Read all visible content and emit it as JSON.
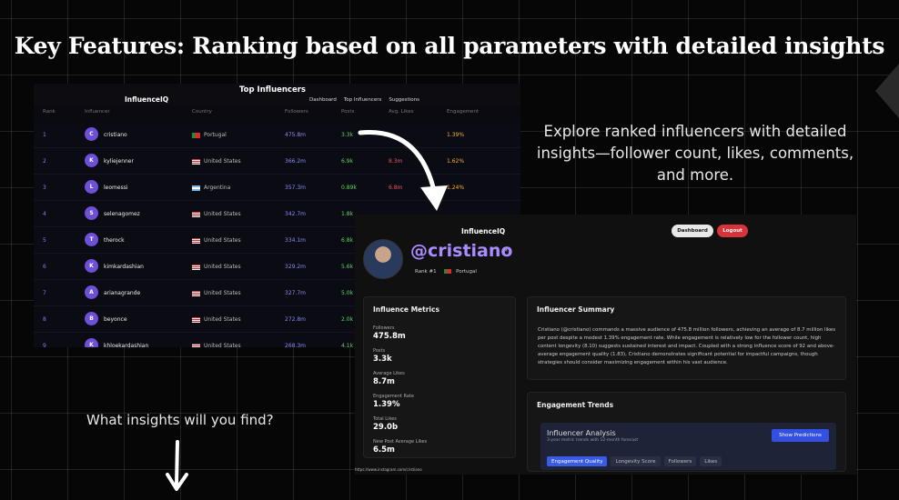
{
  "headline": "Key Features: Ranking based on all parameters with detailed insights",
  "explore_text": "Explore ranked influencers with detailed insights—follower count, likes, comments, and more.",
  "question": "What insights will you find?",
  "ranking": {
    "brand": "InfluenceIQ",
    "title": "Top Influencers",
    "nav": [
      "Dashboard",
      "Top Influencers",
      "Suggestions"
    ],
    "columns": [
      "Rank",
      "Influencer",
      "Country",
      "Followers",
      "Posts",
      "Avg. Likes",
      "Engagement"
    ],
    "rows": [
      {
        "rank": "1",
        "initial": "C",
        "name": "cristiano",
        "country": "Portugal",
        "followers": "475.8m",
        "posts": "3.3k",
        "likes": "",
        "engagement": "1.39%"
      },
      {
        "rank": "2",
        "initial": "K",
        "name": "kyliejenner",
        "country": "United States",
        "followers": "366.2m",
        "posts": "6.9k",
        "likes": "8.3m",
        "engagement": "1.62%"
      },
      {
        "rank": "3",
        "initial": "L",
        "name": "leomessi",
        "country": "Argentina",
        "followers": "357.3m",
        "posts": "0.89k",
        "likes": "6.8m",
        "engagement": "1.24%"
      },
      {
        "rank": "4",
        "initial": "S",
        "name": "selenagomez",
        "country": "United States",
        "followers": "342.7m",
        "posts": "1.8k",
        "likes": "",
        "engagement": ""
      },
      {
        "rank": "5",
        "initial": "T",
        "name": "therock",
        "country": "United States",
        "followers": "334.1m",
        "posts": "6.8k",
        "likes": "",
        "engagement": ""
      },
      {
        "rank": "6",
        "initial": "K",
        "name": "kimkardashian",
        "country": "United States",
        "followers": "329.2m",
        "posts": "5.6k",
        "likes": "",
        "engagement": ""
      },
      {
        "rank": "7",
        "initial": "A",
        "name": "arianagrande",
        "country": "United States",
        "followers": "327.7m",
        "posts": "5.0k",
        "likes": "",
        "engagement": ""
      },
      {
        "rank": "8",
        "initial": "B",
        "name": "beyonce",
        "country": "United States",
        "followers": "272.8m",
        "posts": "2.0k",
        "likes": "",
        "engagement": ""
      },
      {
        "rank": "9",
        "initial": "K",
        "name": "khloekardashian",
        "country": "United States",
        "followers": "268.3m",
        "posts": "4.1k",
        "likes": "",
        "engagement": ""
      }
    ]
  },
  "profile": {
    "brand": "InfluenceIQ",
    "dashboard_label": "Dashboard",
    "logout_label": "Logout",
    "handle": "@cristiano",
    "rank_text": "Rank #1",
    "country": "Portugal",
    "metrics_title": "Influence Metrics",
    "metrics": [
      {
        "label": "Followers",
        "value": "475.8m"
      },
      {
        "label": "Posts",
        "value": "3.3k"
      },
      {
        "label": "Average Likes",
        "value": "8.7m"
      },
      {
        "label": "Engagement Rate",
        "value": "1.39%"
      },
      {
        "label": "Total Likes",
        "value": "29.0b"
      },
      {
        "label": "New Post Average Likes",
        "value": "6.5m"
      }
    ],
    "summary_title": "Influencer Summary",
    "summary_text": "Cristiano (@cristiano) commands a massive audience of 475.8 million followers, achieving an average of 8.7 million likes per post despite a modest 1.39% engagement rate. While engagement is relatively low for the follower count, high content longevity (8.10) suggests sustained interest and impact. Coupled with a strong influence score of 92 and above-average engagement quality (1.83), Cristiano demonstrates significant potential for impactful campaigns, though strategies should consider maximizing engagement within his vast audience.",
    "trends_title": "Engagement Trends",
    "analysis_title": "Influencer Analysis",
    "analysis_sub": "3-year metric trends with 12-month forecast",
    "predict_label": "Show Predictions",
    "tabs": [
      "Engagement Quality",
      "Longevity Score",
      "Followers",
      "Likes"
    ],
    "url": "https://www.instagram.com/cristiano"
  },
  "colors": {
    "accent": "#a98cff",
    "logout": "#d9333a",
    "predict": "#3450e0"
  }
}
